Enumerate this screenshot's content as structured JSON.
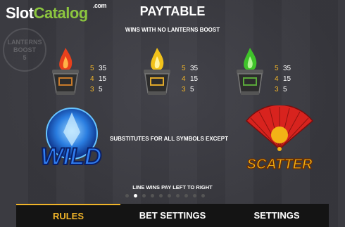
{
  "watermark": {
    "slot": "Slot",
    "catalog": "Catalog",
    "com": ".com"
  },
  "badge": {
    "line1": "LANTERNS",
    "line2": "BOOST",
    "line3": "5"
  },
  "title": "PAYTABLE",
  "subtitle": "WINS WITH NO LANTERNS BOOST",
  "lanterns": [
    {
      "icon": "red-fire-lantern-icon",
      "flame": "#e8401c",
      "pays": [
        {
          "n": "5",
          "v": "35"
        },
        {
          "n": "4",
          "v": "15"
        },
        {
          "n": "3",
          "v": "5"
        }
      ]
    },
    {
      "icon": "yellow-fire-lantern-icon",
      "flame": "#f2c21a",
      "pays": [
        {
          "n": "5",
          "v": "35"
        },
        {
          "n": "4",
          "v": "15"
        },
        {
          "n": "3",
          "v": "5"
        }
      ]
    },
    {
      "icon": "green-fire-lantern-icon",
      "flame": "#3fc42a",
      "pays": [
        {
          "n": "5",
          "v": "35"
        },
        {
          "n": "4",
          "v": "15"
        },
        {
          "n": "3",
          "v": "5"
        }
      ]
    }
  ],
  "wild": {
    "label": "WILD"
  },
  "scatter": {
    "label": "SCATTER"
  },
  "substitutes": "SUBSTITUTES FOR ALL SYMBOLS EXCEPT",
  "line_wins": "LINE WINS PAY LEFT TO RIGHT",
  "pager": {
    "total": 10,
    "active_index": 1
  },
  "menu": [
    {
      "label": "RULES",
      "active": true
    },
    {
      "label": "BET SETTINGS",
      "active": false
    },
    {
      "label": "SETTINGS",
      "active": false
    }
  ],
  "colors": {
    "accent": "#f0b429",
    "menu_bg": "#141414",
    "background": "#37373d"
  }
}
